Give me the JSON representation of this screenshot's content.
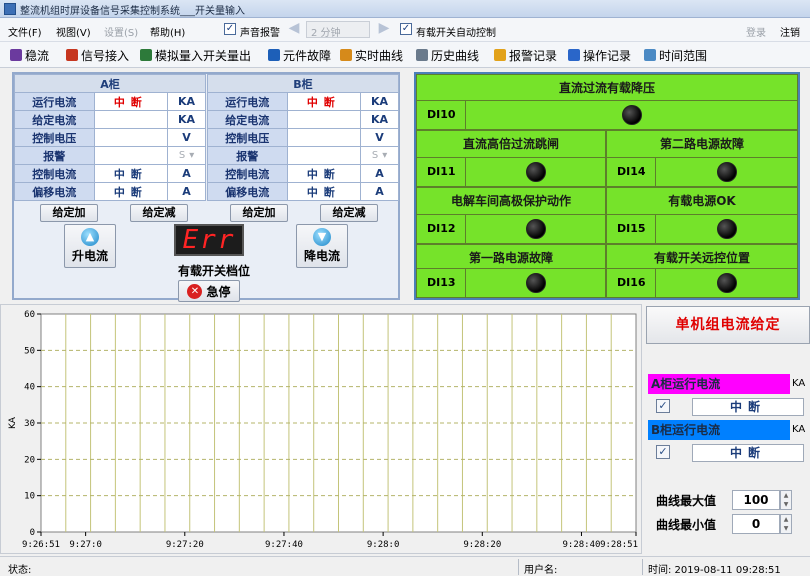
{
  "window": {
    "title": "整流机组时屏设备信号采集控制系统___开关量输入"
  },
  "menu": {
    "file": "文件(F)",
    "view": "视图(V)",
    "settings": "设置(S)",
    "help": "帮助(H)",
    "sound_alarm": "声音报警",
    "sound_alarm_checked": true,
    "interval_value": "2 分钟",
    "auto_tap_control": "有载开关自动控制",
    "auto_tap_checked": true,
    "login": "登录",
    "logout": "注销"
  },
  "toolbar": [
    {
      "label": "稳流",
      "icon": "stabilize-icon",
      "color": "#6b3a9e"
    },
    {
      "label": "信号接入",
      "icon": "signal-input-icon",
      "color": "#c6361f"
    },
    {
      "label": "模拟量入开关量出",
      "icon": "analog-io-icon",
      "color": "#2d7a3a"
    },
    {
      "label": "元件故障",
      "icon": "component-fault-icon",
      "color": "#1d5fb8"
    },
    {
      "label": "实时曲线",
      "icon": "realtime-curve-icon",
      "color": "#d68a1a"
    },
    {
      "label": "历史曲线",
      "icon": "history-curve-icon",
      "color": "#6a7a8c"
    },
    {
      "label": "报警记录",
      "icon": "alarm-record-icon",
      "color": "#e2a21a"
    },
    {
      "label": "操作记录",
      "icon": "operation-record-icon",
      "color": "#2a66c9"
    },
    {
      "label": "时间范围",
      "icon": "time-range-icon",
      "color": "#4b8ac4"
    }
  ],
  "cabinets": [
    {
      "name": "A柜",
      "rows": [
        {
          "label": "运行电流",
          "value": "中断",
          "style": "red",
          "unit": "KA"
        },
        {
          "label": "给定电流",
          "value": "",
          "style": "blue",
          "unit": "KA"
        },
        {
          "label": "控制电压",
          "value": "",
          "style": "blue",
          "unit": "V"
        },
        {
          "label": "报警",
          "value": "",
          "style": "blue",
          "unit": "S"
        },
        {
          "label": "控制电流",
          "value": "中断",
          "style": "blue",
          "unit": "A"
        },
        {
          "label": "偏移电流",
          "value": "中断",
          "style": "blue",
          "unit": "A"
        }
      ],
      "btn_inc": "给定加",
      "btn_dec": "给定减"
    },
    {
      "name": "B柜",
      "rows": [
        {
          "label": "运行电流",
          "value": "中断",
          "style": "red",
          "unit": "KA"
        },
        {
          "label": "给定电流",
          "value": "",
          "style": "blue",
          "unit": "KA"
        },
        {
          "label": "控制电压",
          "value": "",
          "style": "blue",
          "unit": "V"
        },
        {
          "label": "报警",
          "value": "",
          "style": "blue",
          "unit": "S"
        },
        {
          "label": "控制电流",
          "value": "中断",
          "style": "blue",
          "unit": "A"
        },
        {
          "label": "偏移电流",
          "value": "中断",
          "style": "blue",
          "unit": "A"
        }
      ],
      "btn_inc": "给定加",
      "btn_dec": "给定减"
    }
  ],
  "tap": {
    "up_label": "升电流",
    "down_label": "降电流",
    "display": "Err",
    "position_label": "有载开关档位",
    "estop_label": "急停"
  },
  "signals": [
    {
      "id": "DI10",
      "label": "直流过流有载降压",
      "state": "off"
    },
    {
      "id": "DI11",
      "label": "直流高倍过流跳闸",
      "state": "off"
    },
    {
      "id": "DI14",
      "label": "第二路电源故障",
      "state": "off"
    },
    {
      "id": "DI12",
      "label": "电解车间高极保护动作",
      "state": "off"
    },
    {
      "id": "DI15",
      "label": "有载电源OK",
      "state": "off"
    },
    {
      "id": "DI13",
      "label": "第一路电源故障",
      "state": "off"
    },
    {
      "id": "DI16",
      "label": "有载开关远控位置",
      "state": "off"
    }
  ],
  "chart_data": {
    "type": "line",
    "ylabel": "KA",
    "ylim": [
      0,
      60
    ],
    "yticks": [
      0,
      10,
      20,
      30,
      40,
      50,
      60
    ],
    "xticks": [
      "9:26:51",
      "9:27:0",
      "9:27:20",
      "9:27:40",
      "9:28:0",
      "9:28:20",
      "9:28:40",
      "9:28:51"
    ],
    "grid": true,
    "series": []
  },
  "control": {
    "set_button": "单机组电流给定",
    "a_label": "A柜运行电流",
    "a_color": "#ff00ff",
    "a_unit": "KA",
    "a_state": "中断",
    "a_checked": true,
    "b_label": "B柜运行电流",
    "b_color": "#0080ff",
    "b_unit": "KA",
    "b_state": "中断",
    "b_checked": true,
    "max_label": "曲线最大值",
    "max_value": "100",
    "min_label": "曲线最小值",
    "min_value": "0"
  },
  "status": {
    "state_label": "状态:",
    "user_label": "用户名:",
    "time_text": "时间: 2019-08-11 09:28:51"
  }
}
